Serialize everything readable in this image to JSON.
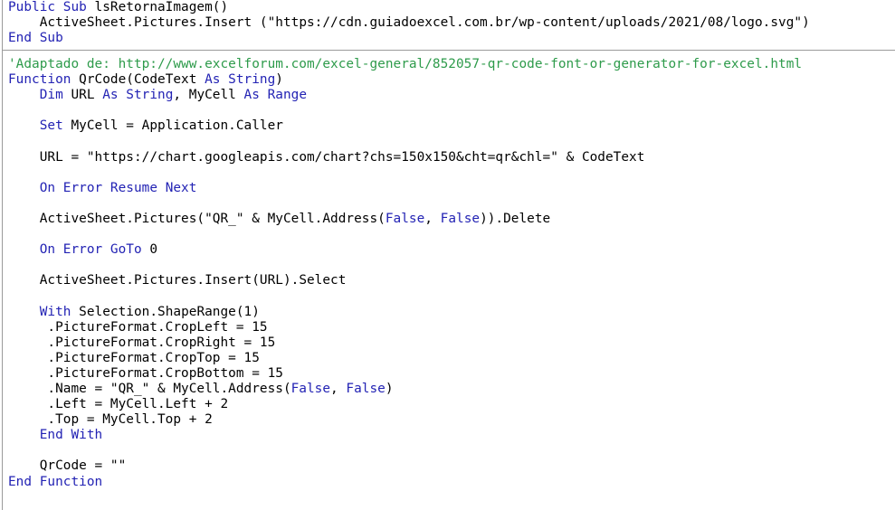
{
  "editor": {
    "language": "VBA",
    "colors": {
      "keyword": "#2323b4",
      "comment": "#2e9b4b",
      "text": "#000000",
      "background": "#ffffff",
      "separator": "#9b9b9b"
    }
  },
  "procedures": {
    "first": {
      "name": "lsRetornaImagem",
      "lines": [
        "Public Sub lsRetornaImagem()",
        "    ActiveSheet.Pictures.Insert (\"https://cdn.guiadoexcel.com.br/wp-content/uploads/2021/08/logo.svg\")",
        "End Sub"
      ]
    },
    "second": {
      "name": "QrCode",
      "lines": [
        "'Adaptado de: http://www.excelforum.com/excel-general/852057-qr-code-font-or-generator-for-excel.html",
        "Function QrCode(CodeText As String)",
        "    Dim URL As String, MyCell As Range",
        "",
        "    Set MyCell = Application.Caller",
        "",
        "    URL = \"https://chart.googleapis.com/chart?chs=150x150&cht=qr&chl=\" & CodeText",
        "",
        "    On Error Resume Next",
        "",
        "    ActiveSheet.Pictures(\"QR_\" & MyCell.Address(False, False)).Delete",
        "",
        "    On Error GoTo 0",
        "",
        "    ActiveSheet.Pictures.Insert(URL).Select",
        "",
        "    With Selection.ShapeRange(1)",
        "     .PictureFormat.CropLeft = 15",
        "     .PictureFormat.CropRight = 15",
        "     .PictureFormat.CropTop = 15",
        "     .PictureFormat.CropBottom = 15",
        "     .Name = \"QR_\" & MyCell.Address(False, False)",
        "     .Left = MyCell.Left + 2",
        "     .Top = MyCell.Top + 2",
        "    End With",
        "",
        "    QrCode = \"\"",
        "End Function"
      ]
    }
  },
  "tokens": {
    "line_1": {
      "kw1": "Public Sub",
      "rest": " lsRetornaImagem()"
    },
    "line_2": {
      "indent": "    ",
      "rest": "ActiveSheet.Pictures.Insert (\"https://cdn.guiadoexcel.com.br/wp-content/uploads/2021/08/logo.svg\")"
    },
    "line_3": {
      "kw1": "End Sub"
    },
    "line_4": {
      "comment": "'Adaptado de: http://www.excelforum.com/excel-general/852057-qr-code-font-or-generator-for-excel.html"
    },
    "line_5": {
      "kw1": "Function",
      "t1": " QrCode(CodeText ",
      "kw2": "As String",
      "t2": ")"
    },
    "line_6": {
      "indent": "    ",
      "kw1": "Dim",
      "t1": " URL ",
      "kw2": "As String",
      "t2": ", MyCell ",
      "kw3": "As Range"
    },
    "line_7": {
      "indent": "    ",
      "kw1": "Set",
      "t1": " MyCell = Application.Caller"
    },
    "line_8": {
      "indent": "    ",
      "t1": "URL = \"https://chart.googleapis.com/chart?chs=150x150&cht=qr&chl=\" & CodeText"
    },
    "line_9": {
      "indent": "    ",
      "kw1": "On Error Resume Next"
    },
    "line_10": {
      "indent": "    ",
      "t1": "ActiveSheet.Pictures(\"QR_\" & MyCell.Address(",
      "kw1": "False",
      "t2": ", ",
      "kw2": "False",
      "t3": ")).Delete"
    },
    "line_11": {
      "indent": "    ",
      "kw1": "On Error GoTo",
      "t1": " 0"
    },
    "line_12": {
      "indent": "    ",
      "t1": "ActiveSheet.Pictures.Insert(URL).Select"
    },
    "line_13": {
      "indent": "    ",
      "kw1": "With",
      "t1": " Selection.ShapeRange(1)"
    },
    "line_14": {
      "indent": "     ",
      "t1": ".PictureFormat.CropLeft = 15"
    },
    "line_15": {
      "indent": "     ",
      "t1": ".PictureFormat.CropRight = 15"
    },
    "line_16": {
      "indent": "     ",
      "t1": ".PictureFormat.CropTop = 15"
    },
    "line_17": {
      "indent": "     ",
      "t1": ".PictureFormat.CropBottom = 15"
    },
    "line_18": {
      "indent": "     ",
      "t1": ".Name = \"QR_\" & MyCell.Address(",
      "kw1": "False",
      "t2": ", ",
      "kw2": "False",
      "t3": ")"
    },
    "line_19": {
      "indent": "     ",
      "t1": ".Left = MyCell.Left + 2"
    },
    "line_20": {
      "indent": "     ",
      "t1": ".Top = MyCell.Top + 2"
    },
    "line_21": {
      "indent": "    ",
      "kw1": "End With"
    },
    "line_22": {
      "indent": "    ",
      "t1": "QrCode = \"\""
    },
    "line_23": {
      "kw1": "End Function"
    }
  }
}
